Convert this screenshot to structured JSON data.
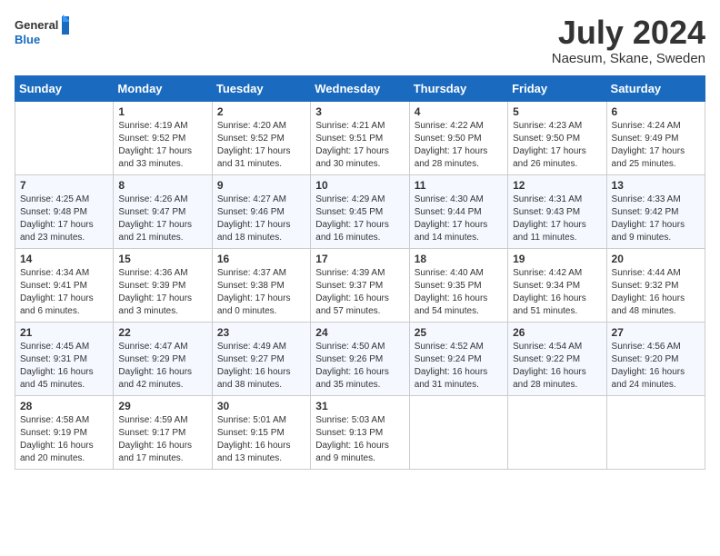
{
  "header": {
    "logo_line1": "General",
    "logo_line2": "Blue",
    "month_title": "July 2024",
    "location": "Naesum, Skane, Sweden"
  },
  "days_of_week": [
    "Sunday",
    "Monday",
    "Tuesday",
    "Wednesday",
    "Thursday",
    "Friday",
    "Saturday"
  ],
  "weeks": [
    [
      {
        "day": "",
        "info": ""
      },
      {
        "day": "1",
        "info": "Sunrise: 4:19 AM\nSunset: 9:52 PM\nDaylight: 17 hours\nand 33 minutes."
      },
      {
        "day": "2",
        "info": "Sunrise: 4:20 AM\nSunset: 9:52 PM\nDaylight: 17 hours\nand 31 minutes."
      },
      {
        "day": "3",
        "info": "Sunrise: 4:21 AM\nSunset: 9:51 PM\nDaylight: 17 hours\nand 30 minutes."
      },
      {
        "day": "4",
        "info": "Sunrise: 4:22 AM\nSunset: 9:50 PM\nDaylight: 17 hours\nand 28 minutes."
      },
      {
        "day": "5",
        "info": "Sunrise: 4:23 AM\nSunset: 9:50 PM\nDaylight: 17 hours\nand 26 minutes."
      },
      {
        "day": "6",
        "info": "Sunrise: 4:24 AM\nSunset: 9:49 PM\nDaylight: 17 hours\nand 25 minutes."
      }
    ],
    [
      {
        "day": "7",
        "info": "Sunrise: 4:25 AM\nSunset: 9:48 PM\nDaylight: 17 hours\nand 23 minutes."
      },
      {
        "day": "8",
        "info": "Sunrise: 4:26 AM\nSunset: 9:47 PM\nDaylight: 17 hours\nand 21 minutes."
      },
      {
        "day": "9",
        "info": "Sunrise: 4:27 AM\nSunset: 9:46 PM\nDaylight: 17 hours\nand 18 minutes."
      },
      {
        "day": "10",
        "info": "Sunrise: 4:29 AM\nSunset: 9:45 PM\nDaylight: 17 hours\nand 16 minutes."
      },
      {
        "day": "11",
        "info": "Sunrise: 4:30 AM\nSunset: 9:44 PM\nDaylight: 17 hours\nand 14 minutes."
      },
      {
        "day": "12",
        "info": "Sunrise: 4:31 AM\nSunset: 9:43 PM\nDaylight: 17 hours\nand 11 minutes."
      },
      {
        "day": "13",
        "info": "Sunrise: 4:33 AM\nSunset: 9:42 PM\nDaylight: 17 hours\nand 9 minutes."
      }
    ],
    [
      {
        "day": "14",
        "info": "Sunrise: 4:34 AM\nSunset: 9:41 PM\nDaylight: 17 hours\nand 6 minutes."
      },
      {
        "day": "15",
        "info": "Sunrise: 4:36 AM\nSunset: 9:39 PM\nDaylight: 17 hours\nand 3 minutes."
      },
      {
        "day": "16",
        "info": "Sunrise: 4:37 AM\nSunset: 9:38 PM\nDaylight: 17 hours\nand 0 minutes."
      },
      {
        "day": "17",
        "info": "Sunrise: 4:39 AM\nSunset: 9:37 PM\nDaylight: 16 hours\nand 57 minutes."
      },
      {
        "day": "18",
        "info": "Sunrise: 4:40 AM\nSunset: 9:35 PM\nDaylight: 16 hours\nand 54 minutes."
      },
      {
        "day": "19",
        "info": "Sunrise: 4:42 AM\nSunset: 9:34 PM\nDaylight: 16 hours\nand 51 minutes."
      },
      {
        "day": "20",
        "info": "Sunrise: 4:44 AM\nSunset: 9:32 PM\nDaylight: 16 hours\nand 48 minutes."
      }
    ],
    [
      {
        "day": "21",
        "info": "Sunrise: 4:45 AM\nSunset: 9:31 PM\nDaylight: 16 hours\nand 45 minutes."
      },
      {
        "day": "22",
        "info": "Sunrise: 4:47 AM\nSunset: 9:29 PM\nDaylight: 16 hours\nand 42 minutes."
      },
      {
        "day": "23",
        "info": "Sunrise: 4:49 AM\nSunset: 9:27 PM\nDaylight: 16 hours\nand 38 minutes."
      },
      {
        "day": "24",
        "info": "Sunrise: 4:50 AM\nSunset: 9:26 PM\nDaylight: 16 hours\nand 35 minutes."
      },
      {
        "day": "25",
        "info": "Sunrise: 4:52 AM\nSunset: 9:24 PM\nDaylight: 16 hours\nand 31 minutes."
      },
      {
        "day": "26",
        "info": "Sunrise: 4:54 AM\nSunset: 9:22 PM\nDaylight: 16 hours\nand 28 minutes."
      },
      {
        "day": "27",
        "info": "Sunrise: 4:56 AM\nSunset: 9:20 PM\nDaylight: 16 hours\nand 24 minutes."
      }
    ],
    [
      {
        "day": "28",
        "info": "Sunrise: 4:58 AM\nSunset: 9:19 PM\nDaylight: 16 hours\nand 20 minutes."
      },
      {
        "day": "29",
        "info": "Sunrise: 4:59 AM\nSunset: 9:17 PM\nDaylight: 16 hours\nand 17 minutes."
      },
      {
        "day": "30",
        "info": "Sunrise: 5:01 AM\nSunset: 9:15 PM\nDaylight: 16 hours\nand 13 minutes."
      },
      {
        "day": "31",
        "info": "Sunrise: 5:03 AM\nSunset: 9:13 PM\nDaylight: 16 hours\nand 9 minutes."
      },
      {
        "day": "",
        "info": ""
      },
      {
        "day": "",
        "info": ""
      },
      {
        "day": "",
        "info": ""
      }
    ]
  ]
}
